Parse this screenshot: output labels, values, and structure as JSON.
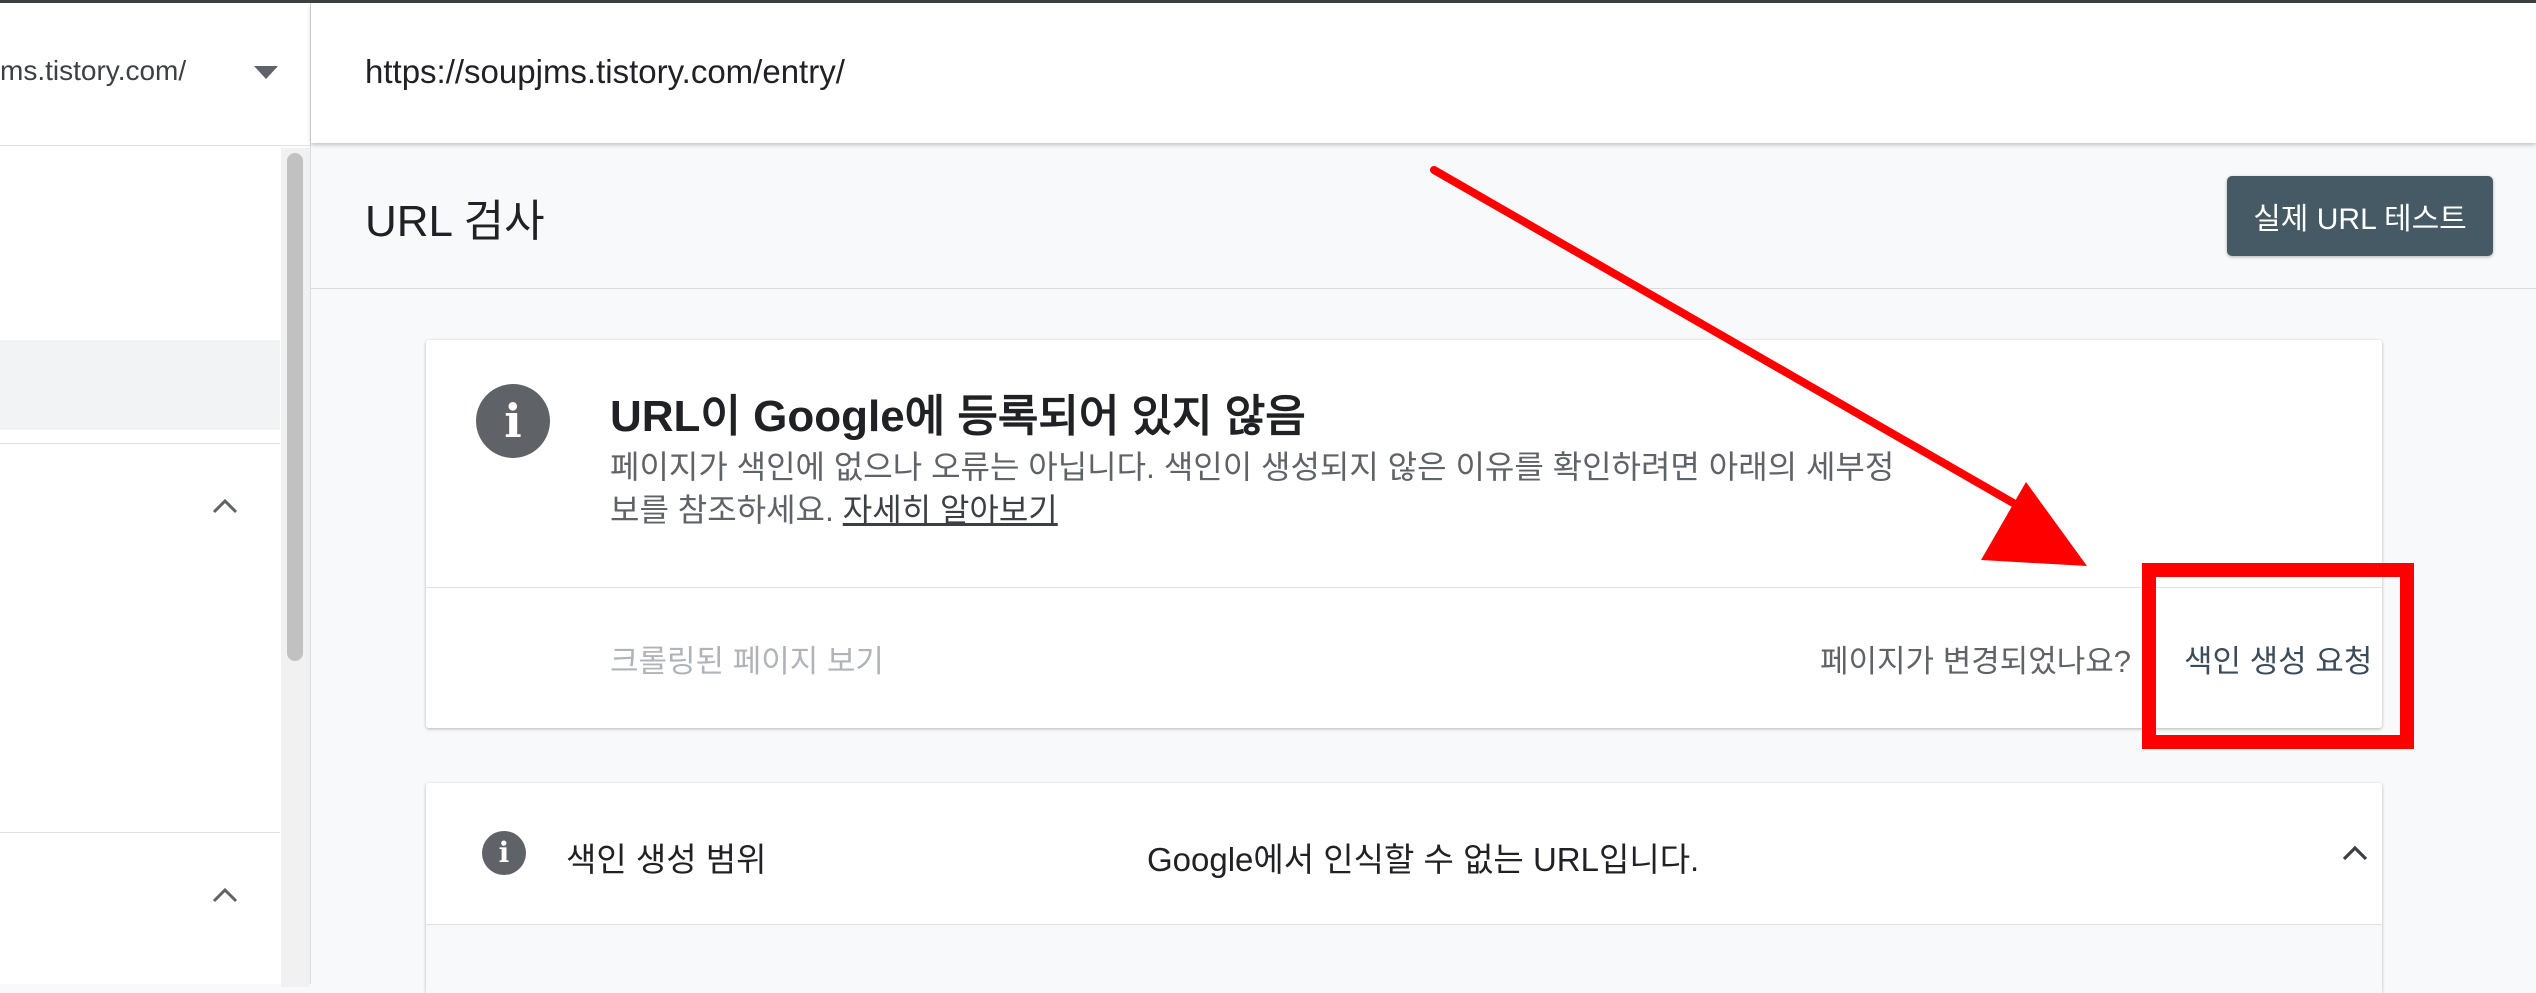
{
  "sidebar": {
    "property": "ms.tistory.com/"
  },
  "url_bar": {
    "value": "https://soupjms.tistory.com/entry/"
  },
  "header": {
    "title": "URL 검사",
    "live_test_label": "실제 URL 테스트"
  },
  "status_card": {
    "title": "URL이 Google에 등록되어 있지 않음",
    "description": "페이지가 색인에 없으나 오류는 아닙니다. 색인이 생성되지 않은 이유를 확인하려면 아래의 세부정보를 참조하세요. ",
    "learn_more": "자세히 알아보기",
    "view_crawled": "크롤링된 페이지 보기",
    "page_changed": "페이지가 변경되었나요?",
    "request_indexing": "색인 생성 요청"
  },
  "coverage_card": {
    "label": "색인 생성 범위",
    "value": "Google에서 인식할 수 없는 URL입니다."
  },
  "icons": {
    "info": "info-icon",
    "dropdown": "caret-down-icon",
    "expand": "chevron-up-icon"
  },
  "colors": {
    "annotation": "#ff0000",
    "button": "#455a64"
  }
}
